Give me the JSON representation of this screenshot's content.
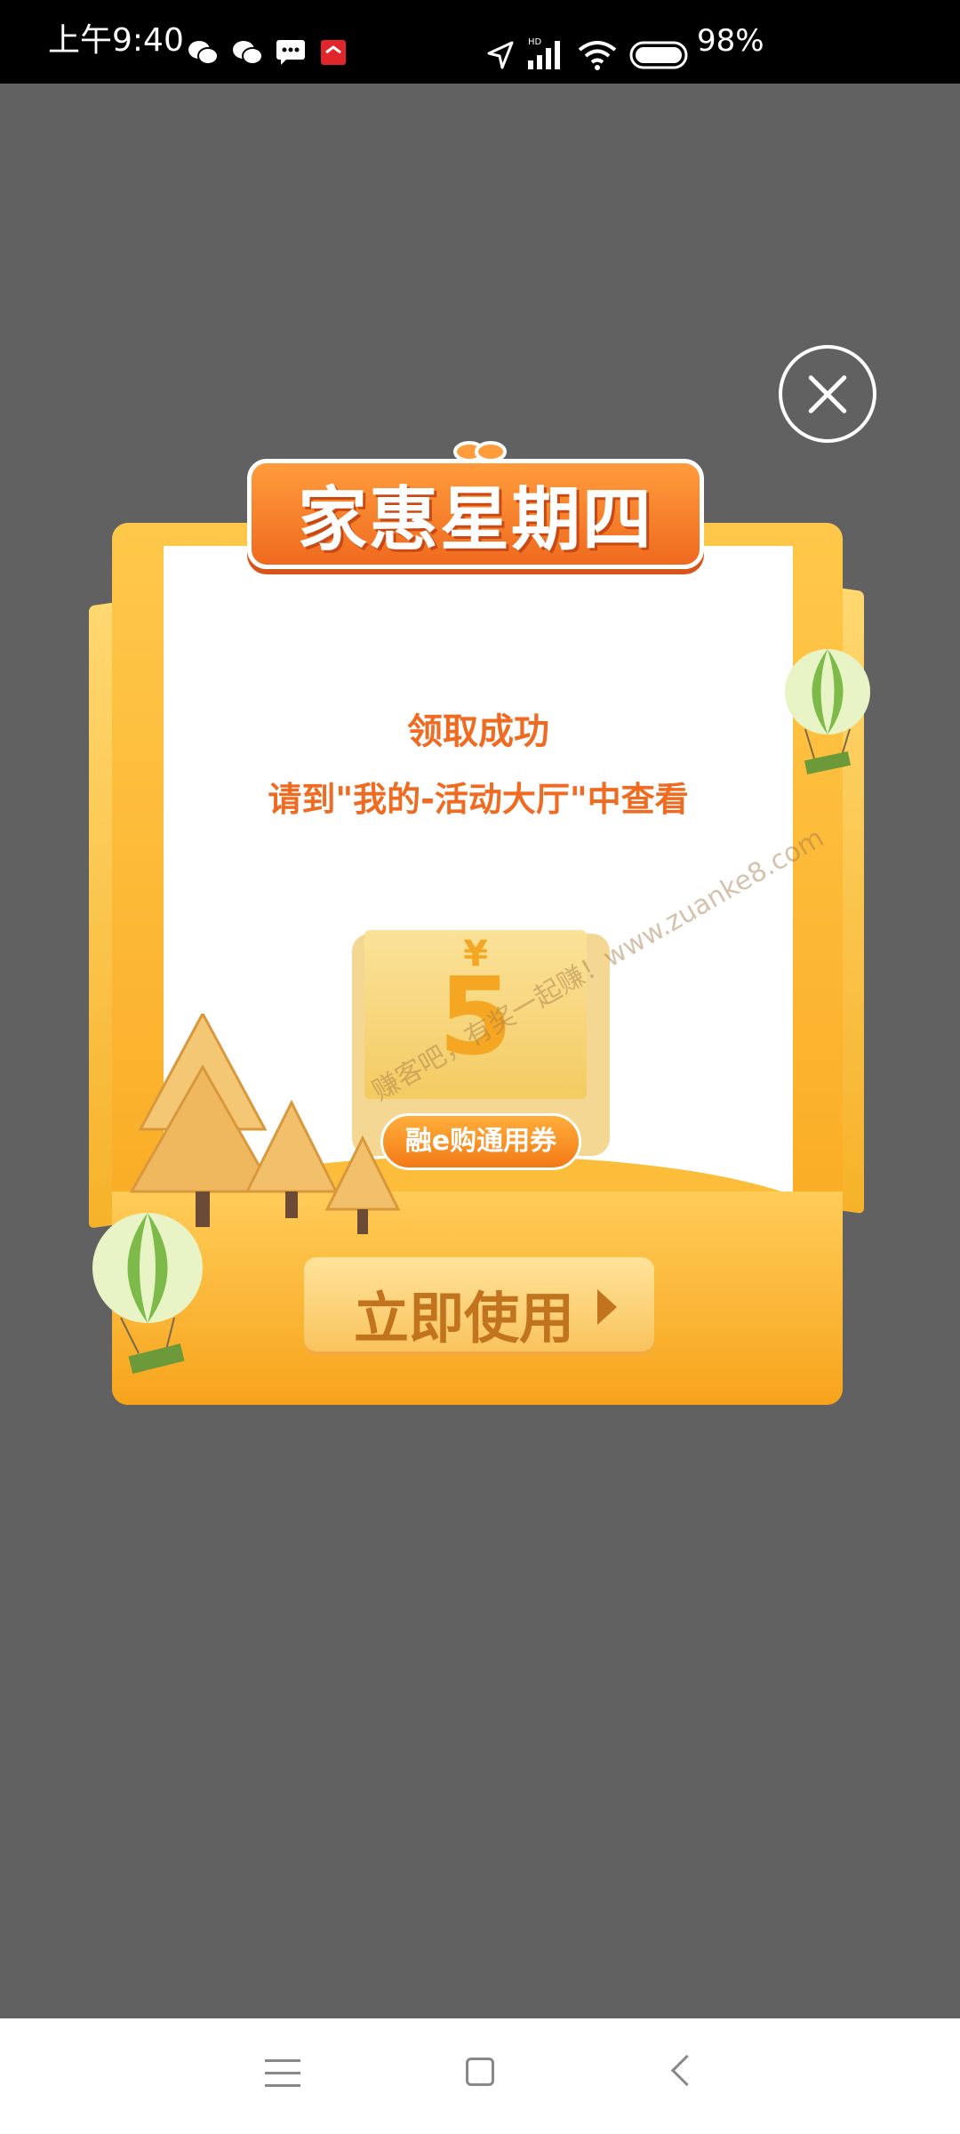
{
  "status_bar": {
    "time": "上午9:40",
    "battery": "98%",
    "icons": [
      "wechat-icon",
      "wechat-icon",
      "message-icon",
      "app-icon",
      "location-icon",
      "signal-icon",
      "wifi-icon",
      "battery-icon"
    ]
  },
  "modal": {
    "banner_title": "家惠星期四",
    "message_title": "领取成功",
    "message_body": "请到\"我的-活动大厅\"中查看",
    "coupon": {
      "currency": "¥",
      "amount": "5",
      "label": "融e购通用券"
    },
    "use_button": "立即使用",
    "watermark": "赚客吧，有奖一起赚！www.zuanke8.com"
  },
  "colors": {
    "overlay": "#616161",
    "accent_orange": "#ef6b22",
    "frame_gold": "#f9a51c"
  }
}
